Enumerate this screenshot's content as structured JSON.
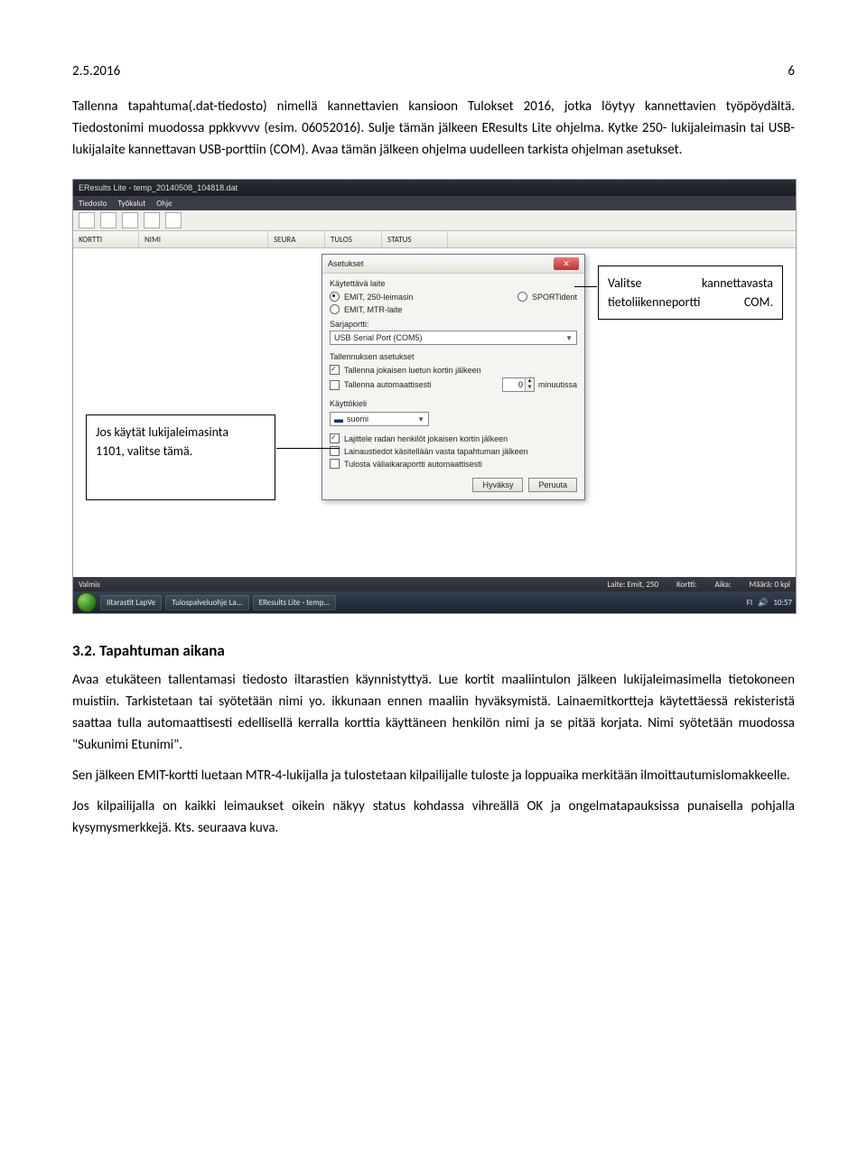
{
  "header": {
    "date": "2.5.2016",
    "page_number": "6"
  },
  "para1": "Tallenna tapahtuma(.dat-tiedosto) nimellä kannettavien kansioon Tulokset 2016, jotka löytyy kannettavien työpöydältä. Tiedostonimi muodossa ppkkvvvv (esim. 06052016). Sulje tämän jälkeen EResults Lite ohjelma. Kytke 250- lukijaleimasin tai USB-lukijalaite kannettavan USB-porttiin (COM). Avaa tämän jälkeen ohjelma uudelleen tarkista ohjelman asetukset.",
  "screenshot": {
    "window_title": "EResults Lite - temp_20140508_104818.dat",
    "menu": {
      "tiedosto": "Tiedosto",
      "tyokalut": "Työkalut",
      "ohje": "Ohje"
    },
    "table_head": {
      "kortti": "KORTTI",
      "nimi": "NIMI",
      "seura": "SEURA",
      "tulos": "TULOS",
      "status": "STATUS"
    },
    "dialog": {
      "title": "Asetukset",
      "device_group": "Käytettävä laite",
      "opt_emit250": "EMIT, 250-leimasin",
      "opt_sportident": "SPORTident",
      "opt_emit_mtr": "EMIT, MTR-laite",
      "sarjaportti_label": "Sarjaportti:",
      "sarjaportti_value": "USB Serial Port (COM5)",
      "save_group": "Tallennuksen asetukset",
      "chk_save_each": "Tallenna jokaisen luetun kortin jälkeen",
      "chk_autosave": "Tallenna automaattisesti",
      "autosave_value": "0",
      "autosave_unit": "minuutissa",
      "lang_group": "Käyttökieli",
      "lang_value": "suomi",
      "chk_sort": "Lajittele radan henkilöt jokaisen kortin jälkeen",
      "chk_borrow": "Lainaustiedot käsitellään vasta tapahtuman jälkeen",
      "chk_print": "Tulosta väliaikaraportti automaattisesti",
      "btn_ok": "Hyväksy",
      "btn_cancel": "Peruuta"
    },
    "status": {
      "valmis": "Valmis",
      "laite": "Laite: Emit, 250",
      "kortti": "Kortti:",
      "aika": "Aika:",
      "maara": "Määrä: 0 kpl"
    },
    "taskbar": {
      "item1": "Iltarastit LapVe",
      "item2": "Tulospalveluohje La...",
      "item3": "EResults Lite - temp...",
      "lang": "FI",
      "clock": "10:57"
    }
  },
  "callout_right_l1": "Valitse",
  "callout_right_l1b": "kannettavasta",
  "callout_right_l2": "tietoliikenneportti",
  "callout_right_l2b": "COM.",
  "callout_left_l1": "Jos käytät lukijaleimasinta",
  "callout_left_l2": "1101, valitse tämä.",
  "section_head": "3.2. Tapahtuman aikana",
  "para2": "Avaa etukäteen tallentamasi tiedosto iltarastien käynnistyttyä. Lue kortit maaliintulon jälkeen lukijaleimasimella tietokoneen muistiin. Tarkistetaan tai syötetään nimi yo. ikkunaan ennen maaliin hyväksymistä. Lainaemitkortteja käytettäessä rekisteristä saattaa tulla automaattisesti edellisellä kerralla korttia käyttäneen henkilön nimi ja se pitää korjata. Nimi syötetään muodossa \"Sukunimi Etunimi\".",
  "para3": "Sen jälkeen EMIT-kortti luetaan MTR-4-lukijalla ja tulostetaan kilpailijalle tuloste ja loppuaika merkitään ilmoittautumislomakkeelle.",
  "para4": "Jos kilpailijalla on kaikki leimaukset oikein näkyy status kohdassa vihreällä OK ja ongelmatapauksissa punaisella pohjalla kysymysmerkkejä. Kts. seuraava kuva."
}
